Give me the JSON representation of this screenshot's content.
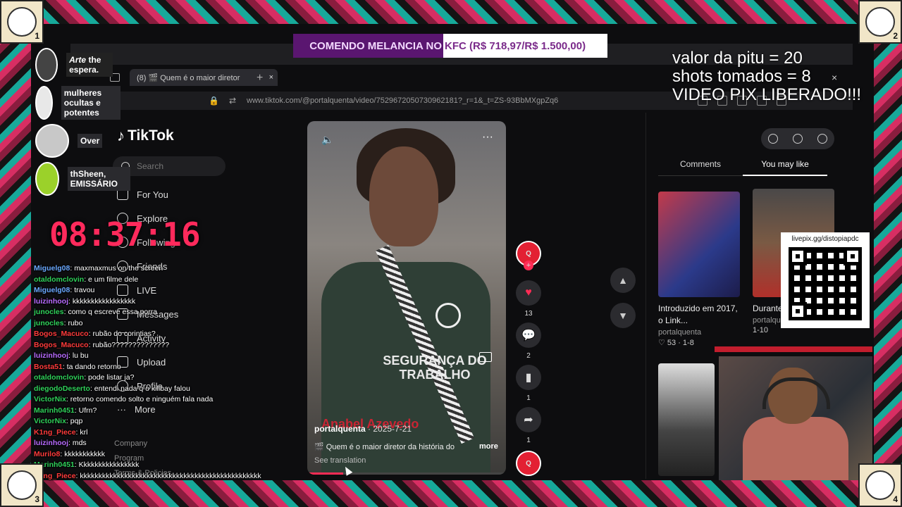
{
  "stream": {
    "banner_left": "COMENDO MELANCIA NO",
    "banner_right": "KFC (R$ 718,97/R$ 1.500,00)",
    "stats": [
      "valor da pitu = 20",
      "shots tomados = 8",
      "VIDEO PIX LIBERADO!!!"
    ],
    "timer": "08:37:16",
    "corner_labels": [
      "1",
      "2",
      "3",
      "4"
    ],
    "members": [
      {
        "name_prefix": "Arte",
        "name": " the espera.",
        "color": "#555555"
      },
      {
        "name": "mulheres ocultas e potentes",
        "color": "#e8e8e8"
      },
      {
        "name": "Over",
        "color": "#c8c8c8"
      },
      {
        "name": "thSheen, EMISSÁRIO",
        "color": "#9bd12a"
      }
    ],
    "qr_label": "livepix.gg/distopiapdc",
    "chat": [
      {
        "user": "Miguelg08",
        "msg": "maxmaxmus on the screen",
        "color": "#6aa8ff"
      },
      {
        "user": "otaldomclovin",
        "msg": "e um filme dele",
        "color": "#2fd15a"
      },
      {
        "user": "Miguelg08",
        "msg": "travou",
        "color": "#6aa8ff"
      },
      {
        "user": "luizinhooj",
        "msg": "kkkkkkkkkkkkkkkkk",
        "color": "#b86bff"
      },
      {
        "user": "junocles",
        "msg": "como q escreve essa porra",
        "color": "#2fd15a"
      },
      {
        "user": "junocles",
        "msg": "rubo",
        "color": "#2fd15a"
      },
      {
        "user": "Bogos_Macuco",
        "msg": "rubão do corintias?",
        "color": "#ff3b3b"
      },
      {
        "user": "Bogos_Macuco",
        "msg": "rubão??????????????",
        "color": "#ff3b3b"
      },
      {
        "user": "luizinhooj",
        "msg": "lu bu",
        "color": "#b86bff"
      },
      {
        "user": "Bosta51",
        "msg": "ta dando retorno",
        "color": "#ff3b3b"
      },
      {
        "user": "otaldomclovin",
        "msg": "pode listar ja?",
        "color": "#2fd15a"
      },
      {
        "user": "diegodoDeserto",
        "msg": "entendi nada q o killbay falou",
        "color": "#2fd15a"
      },
      {
        "user": "VictorNix",
        "msg": "retorno comendo solto e ninguém fala nada",
        "color": "#2fd15a"
      },
      {
        "user": "Marinh0451",
        "msg": "Ufrn?",
        "color": "#2fd15a"
      },
      {
        "user": "VictorNix",
        "msg": "pqp",
        "color": "#2fd15a"
      },
      {
        "user": "K1ng_Piece",
        "msg": "krl",
        "color": "#ff3b3b"
      },
      {
        "user": "luizinhooj",
        "msg": "mds",
        "color": "#b86bff"
      },
      {
        "user": "Murilo8",
        "msg": "kkkkkkkkkkk",
        "color": "#ff3b3b"
      },
      {
        "user": "Marinh0451",
        "msg": "Kkkkkkkkkkkkkkkk",
        "color": "#2fd15a"
      },
      {
        "user": "K1ng_Piece",
        "msg": "kkkkkkkkkkkkkkkkkkkkkkkkkkkkkkkkkkkkkkkkkkkkkkkkk",
        "color": "#ff3b3b"
      }
    ]
  },
  "browser": {
    "tab_title": "(8) 🎬 Quem é o maior diretor",
    "url": "www.tiktok.com/@portalquenta/video/7529672050730962181?_r=1&_t=ZS-93BbMXgpZq6",
    "close": "×",
    "new_tab": "+"
  },
  "tiktok": {
    "logo": "TikTok",
    "search_placeholder": "Search",
    "nav": [
      "For You",
      "Explore",
      "Following",
      "Friends",
      "LIVE",
      "Messages",
      "Activity",
      "Upload",
      "Profile",
      "More"
    ],
    "footer": [
      "Company",
      "Program",
      "Terms & Policies"
    ],
    "video": {
      "user": "portalquenta",
      "date": "· 2025-7-21",
      "caption": "🎬 Quem é o maior diretor da história do",
      "more": "more",
      "see_translation": "See translation",
      "overlay": "Anabel Azevedo",
      "shirt_text": "SEGURANÇA DO TRABALHO",
      "progress": 0.18
    },
    "actions": {
      "likes": "13",
      "comments": "2",
      "saves": "1",
      "shares": "1"
    },
    "right_panel": {
      "tabs": [
        "Comments",
        "You may like"
      ],
      "active_tab": "You may like",
      "cards": [
        {
          "title": "Introduzido em 2017, o Link...",
          "user": "portalquenta",
          "likes": "53 · 1-8"
        },
        {
          "title": "Durante conversa...",
          "user": "portalquenta",
          "likes": "1-10"
        }
      ]
    }
  }
}
